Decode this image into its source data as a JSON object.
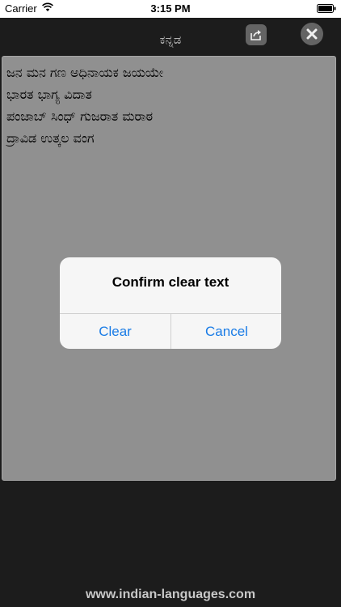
{
  "status_bar": {
    "carrier": "Carrier",
    "time": "3:15 PM"
  },
  "nav": {
    "title": "ಕನ್ನಡ",
    "share_icon": "share-icon",
    "close_icon": "close-icon"
  },
  "editor": {
    "lines": [
      "ಜನ ಮನ ಗಣ ಅಧಿನಾಯಕ ಜಯಯೇ",
      "ಭಾರತ ಭಾಗ್ಯ ವಿದಾತ",
      "ಪಂಜಾಬ್ ಸಿಂಧ್ ಗುಜರಾತ ಮರಾಠ",
      "ದ್ರಾವಿಡ ಉತ್ಕಲ ವಂಗ"
    ]
  },
  "dialog": {
    "title": "Confirm clear text",
    "clear_label": "Clear",
    "cancel_label": "Cancel"
  },
  "footer": {
    "text": "www.indian-languages.com"
  },
  "colors": {
    "accent": "#1a7ce6",
    "background": "#1e1e1e",
    "editor_bg": "#9a9a9a"
  }
}
